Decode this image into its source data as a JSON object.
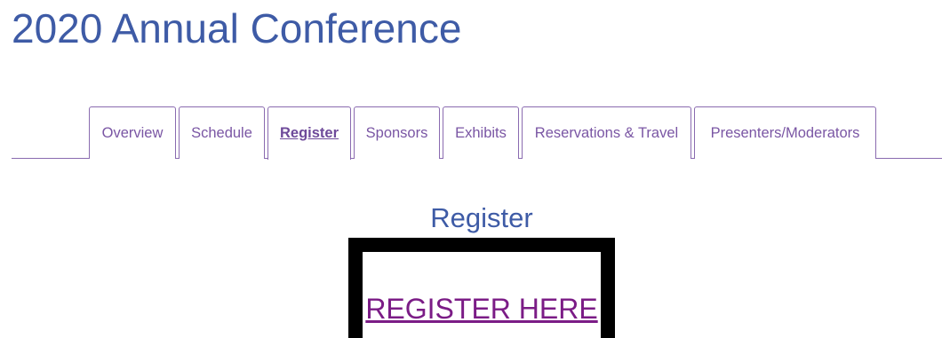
{
  "page": {
    "title": "2020 Annual Conference"
  },
  "tabs": [
    {
      "label": "Overview",
      "active": false
    },
    {
      "label": "Schedule",
      "active": false
    },
    {
      "label": "Register",
      "active": true
    },
    {
      "label": "Sponsors",
      "active": false
    },
    {
      "label": "Exhibits",
      "active": false
    },
    {
      "label": "Reservations & Travel",
      "active": false
    },
    {
      "label": "Presenters/Moderators",
      "active": false
    }
  ],
  "main": {
    "heading": "Register",
    "register_link_label": "REGISTER HERE"
  },
  "colors": {
    "title_blue": "#3e5ba6",
    "tab_purple": "#7a56a4",
    "link_purple": "#7b1c86",
    "box_border": "#000000"
  }
}
